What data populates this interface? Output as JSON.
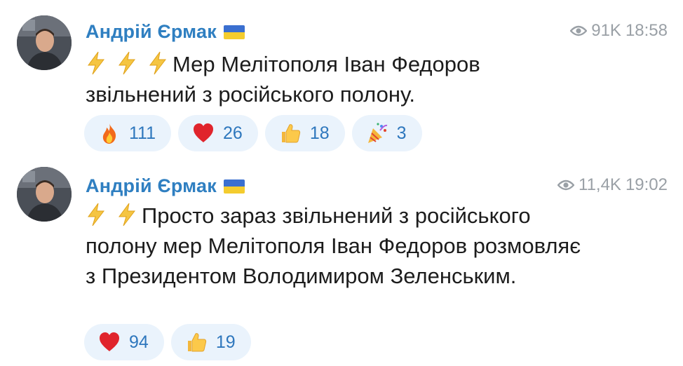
{
  "posts": [
    {
      "author": "Андрій Єрмак",
      "views": "91K",
      "time": "18:58",
      "text": "Мер Мелітополя Іван Федоров звільнений з російського полону.",
      "bolt_count": 3,
      "reactions": [
        {
          "icon": "fire",
          "count": "111"
        },
        {
          "icon": "heart",
          "count": "26"
        },
        {
          "icon": "thumbs-up",
          "count": "18"
        },
        {
          "icon": "party-popper",
          "count": "3"
        }
      ]
    },
    {
      "author": "Андрій Єрмак",
      "views": "11,4K",
      "time": "19:02",
      "text": "Просто зараз звільнений з російського полону мер Мелітополя Іван Федоров розмовляє з Президентом Володимиром Зеленським.",
      "bolt_count": 2,
      "reactions": [
        {
          "icon": "heart",
          "count": "94"
        },
        {
          "icon": "thumbs-up",
          "count": "19"
        }
      ]
    }
  ],
  "colors": {
    "author": "#2f7fc1",
    "meta": "#9aa0a6",
    "reaction_bg": "#eaf3fc",
    "reaction_text": "#2e77bd"
  }
}
